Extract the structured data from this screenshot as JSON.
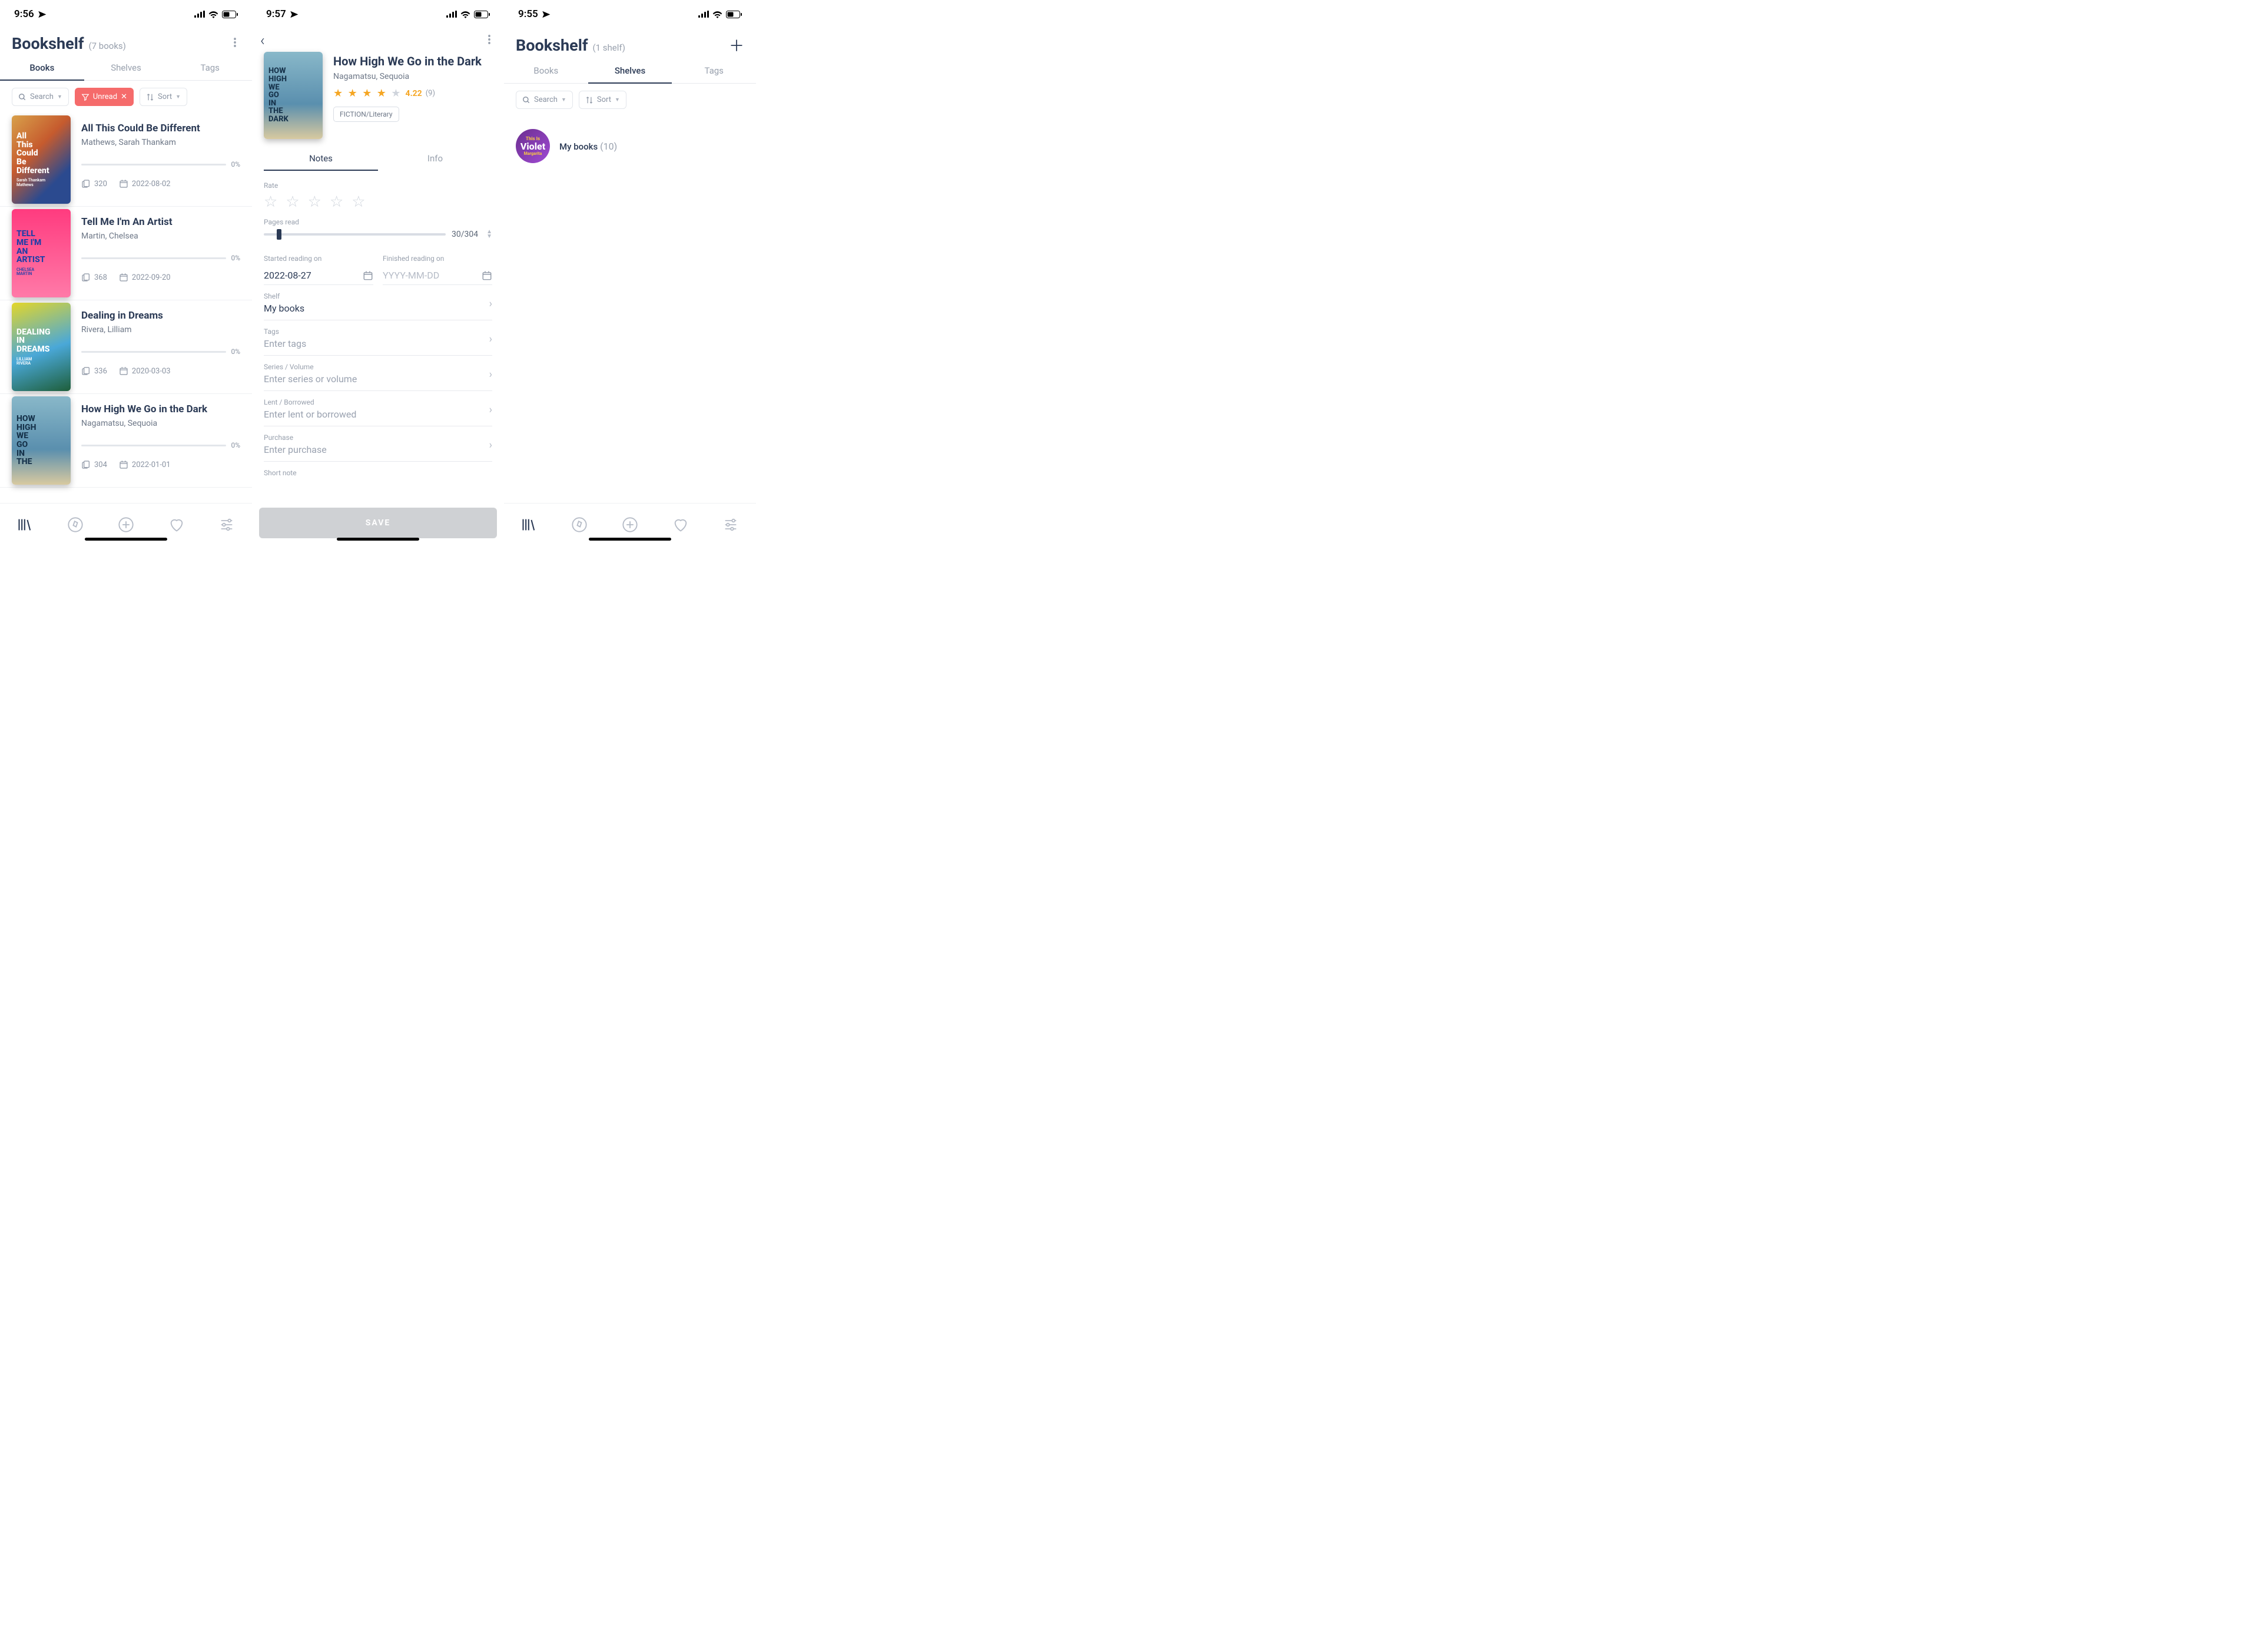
{
  "screen1": {
    "status": {
      "time": "9:56"
    },
    "header": {
      "title": "Bookshelf",
      "subtitle": "(7 books)"
    },
    "tabs": [
      "Books",
      "Shelves",
      "Tags"
    ],
    "active_tab": 0,
    "filters": {
      "search_placeholder": "Search",
      "unread_label": "Unread",
      "sort_label": "Sort"
    },
    "books": [
      {
        "title": "All This Could Be Different",
        "author": "Mathews, Sarah Thankam",
        "progress": "0%",
        "pages": "320",
        "date": "2022-08-02",
        "cover": {
          "bg": "linear-gradient(135deg,#d8a04a,#c65b2e 40%,#2b4a8f 75%)",
          "fg": "#ffffff",
          "lines": [
            "All",
            "This",
            "Could",
            "Be",
            "Different"
          ],
          "small": "Sarah Thankam\\nMathews"
        }
      },
      {
        "title": "Tell Me I'm An Artist",
        "author": "Martin, Chelsea",
        "progress": "0%",
        "pages": "368",
        "date": "2022-09-20",
        "cover": {
          "bg": "linear-gradient(180deg,#ff3b7f,#ff7aa8)",
          "fg": "#1e3ea8",
          "lines": [
            "TELL",
            "ME I'M",
            "AN",
            "ARTIST"
          ],
          "small": "CHELSEA\\nMARTIN"
        }
      },
      {
        "title": "Dealing in Dreams",
        "author": "Rivera, Lilliam",
        "progress": "0%",
        "pages": "336",
        "date": "2020-03-03",
        "cover": {
          "bg": "linear-gradient(160deg,#e3d62a 0%,#4aa8d8 55%,#1e5e3a 100%)",
          "fg": "#ffffff",
          "lines": [
            "DEALING",
            "IN",
            "DREAMS"
          ],
          "small": "LILLIAM\\nRIVERA"
        }
      },
      {
        "title": "How High We Go in the Dark",
        "author": "Nagamatsu, Sequoia",
        "progress": "0%",
        "pages": "304",
        "date": "2022-01-01",
        "cover": {
          "bg": "linear-gradient(180deg,#89b8c9 0%,#5a8fae 60%,#d8c9a0 100%)",
          "fg": "#16324a",
          "lines": [
            "HOW",
            "HIGH",
            "WE",
            "GO",
            "IN",
            "THE"
          ],
          "small": ""
        }
      }
    ]
  },
  "screen2": {
    "status": {
      "time": "9:57"
    },
    "book": {
      "title": "How High We Go in the Dark",
      "author": "Nagamatsu, Sequoia",
      "rating_value": "4.22",
      "rating_count": "(9)",
      "rating_stars": 4,
      "genre": "FICTION/Literary",
      "cover": {
        "bg": "linear-gradient(180deg,#89b8c9 0%,#5a8fae 60%,#d8c9a0 100%)",
        "fg": "#16324a",
        "lines": [
          "HOW",
          "HIGH",
          "WE",
          "GO",
          "IN",
          "THE",
          "DARK"
        ]
      }
    },
    "sub_tabs": [
      "Notes",
      "Info"
    ],
    "active_sub_tab": 0,
    "form": {
      "rate_label": "Rate",
      "pages_read_label": "Pages read",
      "pages_read": "30/304",
      "pages_read_pct": 10,
      "started_label": "Started reading on",
      "started_value": "2022-08-27",
      "finished_label": "Finished reading on",
      "finished_placeholder": "YYYY-MM-DD",
      "shelf_label": "Shelf",
      "shelf_value": "My books",
      "tags_label": "Tags",
      "tags_placeholder": "Enter tags",
      "series_label": "Series / Volume",
      "series_placeholder": "Enter series or volume",
      "lent_label": "Lent / Borrowed",
      "lent_placeholder": "Enter lent or borrowed",
      "purchase_label": "Purchase",
      "purchase_placeholder": "Enter purchase",
      "note_label": "Short note",
      "save_label": "SAVE"
    }
  },
  "screen3": {
    "status": {
      "time": "9:55"
    },
    "header": {
      "title": "Bookshelf",
      "subtitle": "(1 shelf)"
    },
    "tabs": [
      "Books",
      "Shelves",
      "Tags"
    ],
    "active_tab": 1,
    "filters": {
      "search_placeholder": "Search",
      "sort_label": "Sort"
    },
    "shelves": [
      {
        "name": "My books",
        "count": "(10)",
        "avatar_top": "This Is",
        "avatar_main": "Violet",
        "avatar_bot": "Margarita"
      }
    ]
  }
}
